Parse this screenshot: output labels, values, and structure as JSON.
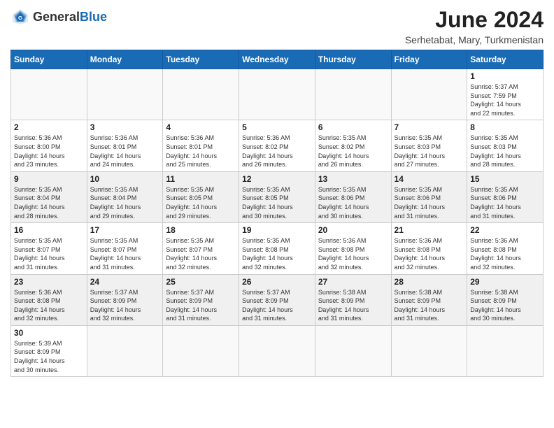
{
  "header": {
    "logo_general": "General",
    "logo_blue": "Blue",
    "month_year": "June 2024",
    "location": "Serhetabat, Mary, Turkmenistan"
  },
  "days_of_week": [
    "Sunday",
    "Monday",
    "Tuesday",
    "Wednesday",
    "Thursday",
    "Friday",
    "Saturday"
  ],
  "weeks": [
    {
      "shaded": false,
      "days": [
        {
          "num": "",
          "info": ""
        },
        {
          "num": "",
          "info": ""
        },
        {
          "num": "",
          "info": ""
        },
        {
          "num": "",
          "info": ""
        },
        {
          "num": "",
          "info": ""
        },
        {
          "num": "",
          "info": ""
        },
        {
          "num": "1",
          "info": "Sunrise: 5:37 AM\nSunset: 7:59 PM\nDaylight: 14 hours\nand 22 minutes."
        }
      ]
    },
    {
      "shaded": false,
      "days": [
        {
          "num": "2",
          "info": "Sunrise: 5:36 AM\nSunset: 8:00 PM\nDaylight: 14 hours\nand 23 minutes."
        },
        {
          "num": "3",
          "info": "Sunrise: 5:36 AM\nSunset: 8:01 PM\nDaylight: 14 hours\nand 24 minutes."
        },
        {
          "num": "4",
          "info": "Sunrise: 5:36 AM\nSunset: 8:01 PM\nDaylight: 14 hours\nand 25 minutes."
        },
        {
          "num": "5",
          "info": "Sunrise: 5:36 AM\nSunset: 8:02 PM\nDaylight: 14 hours\nand 26 minutes."
        },
        {
          "num": "6",
          "info": "Sunrise: 5:35 AM\nSunset: 8:02 PM\nDaylight: 14 hours\nand 26 minutes."
        },
        {
          "num": "7",
          "info": "Sunrise: 5:35 AM\nSunset: 8:03 PM\nDaylight: 14 hours\nand 27 minutes."
        },
        {
          "num": "8",
          "info": "Sunrise: 5:35 AM\nSunset: 8:03 PM\nDaylight: 14 hours\nand 28 minutes."
        }
      ]
    },
    {
      "shaded": true,
      "days": [
        {
          "num": "9",
          "info": "Sunrise: 5:35 AM\nSunset: 8:04 PM\nDaylight: 14 hours\nand 28 minutes."
        },
        {
          "num": "10",
          "info": "Sunrise: 5:35 AM\nSunset: 8:04 PM\nDaylight: 14 hours\nand 29 minutes."
        },
        {
          "num": "11",
          "info": "Sunrise: 5:35 AM\nSunset: 8:05 PM\nDaylight: 14 hours\nand 29 minutes."
        },
        {
          "num": "12",
          "info": "Sunrise: 5:35 AM\nSunset: 8:05 PM\nDaylight: 14 hours\nand 30 minutes."
        },
        {
          "num": "13",
          "info": "Sunrise: 5:35 AM\nSunset: 8:06 PM\nDaylight: 14 hours\nand 30 minutes."
        },
        {
          "num": "14",
          "info": "Sunrise: 5:35 AM\nSunset: 8:06 PM\nDaylight: 14 hours\nand 31 minutes."
        },
        {
          "num": "15",
          "info": "Sunrise: 5:35 AM\nSunset: 8:06 PM\nDaylight: 14 hours\nand 31 minutes."
        }
      ]
    },
    {
      "shaded": false,
      "days": [
        {
          "num": "16",
          "info": "Sunrise: 5:35 AM\nSunset: 8:07 PM\nDaylight: 14 hours\nand 31 minutes."
        },
        {
          "num": "17",
          "info": "Sunrise: 5:35 AM\nSunset: 8:07 PM\nDaylight: 14 hours\nand 31 minutes."
        },
        {
          "num": "18",
          "info": "Sunrise: 5:35 AM\nSunset: 8:07 PM\nDaylight: 14 hours\nand 32 minutes."
        },
        {
          "num": "19",
          "info": "Sunrise: 5:35 AM\nSunset: 8:08 PM\nDaylight: 14 hours\nand 32 minutes."
        },
        {
          "num": "20",
          "info": "Sunrise: 5:36 AM\nSunset: 8:08 PM\nDaylight: 14 hours\nand 32 minutes."
        },
        {
          "num": "21",
          "info": "Sunrise: 5:36 AM\nSunset: 8:08 PM\nDaylight: 14 hours\nand 32 minutes."
        },
        {
          "num": "22",
          "info": "Sunrise: 5:36 AM\nSunset: 8:08 PM\nDaylight: 14 hours\nand 32 minutes."
        }
      ]
    },
    {
      "shaded": true,
      "days": [
        {
          "num": "23",
          "info": "Sunrise: 5:36 AM\nSunset: 8:08 PM\nDaylight: 14 hours\nand 32 minutes."
        },
        {
          "num": "24",
          "info": "Sunrise: 5:37 AM\nSunset: 8:09 PM\nDaylight: 14 hours\nand 32 minutes."
        },
        {
          "num": "25",
          "info": "Sunrise: 5:37 AM\nSunset: 8:09 PM\nDaylight: 14 hours\nand 31 minutes."
        },
        {
          "num": "26",
          "info": "Sunrise: 5:37 AM\nSunset: 8:09 PM\nDaylight: 14 hours\nand 31 minutes."
        },
        {
          "num": "27",
          "info": "Sunrise: 5:38 AM\nSunset: 8:09 PM\nDaylight: 14 hours\nand 31 minutes."
        },
        {
          "num": "28",
          "info": "Sunrise: 5:38 AM\nSunset: 8:09 PM\nDaylight: 14 hours\nand 31 minutes."
        },
        {
          "num": "29",
          "info": "Sunrise: 5:38 AM\nSunset: 8:09 PM\nDaylight: 14 hours\nand 30 minutes."
        }
      ]
    },
    {
      "shaded": false,
      "days": [
        {
          "num": "30",
          "info": "Sunrise: 5:39 AM\nSunset: 8:09 PM\nDaylight: 14 hours\nand 30 minutes."
        },
        {
          "num": "",
          "info": ""
        },
        {
          "num": "",
          "info": ""
        },
        {
          "num": "",
          "info": ""
        },
        {
          "num": "",
          "info": ""
        },
        {
          "num": "",
          "info": ""
        },
        {
          "num": "",
          "info": ""
        }
      ]
    }
  ]
}
